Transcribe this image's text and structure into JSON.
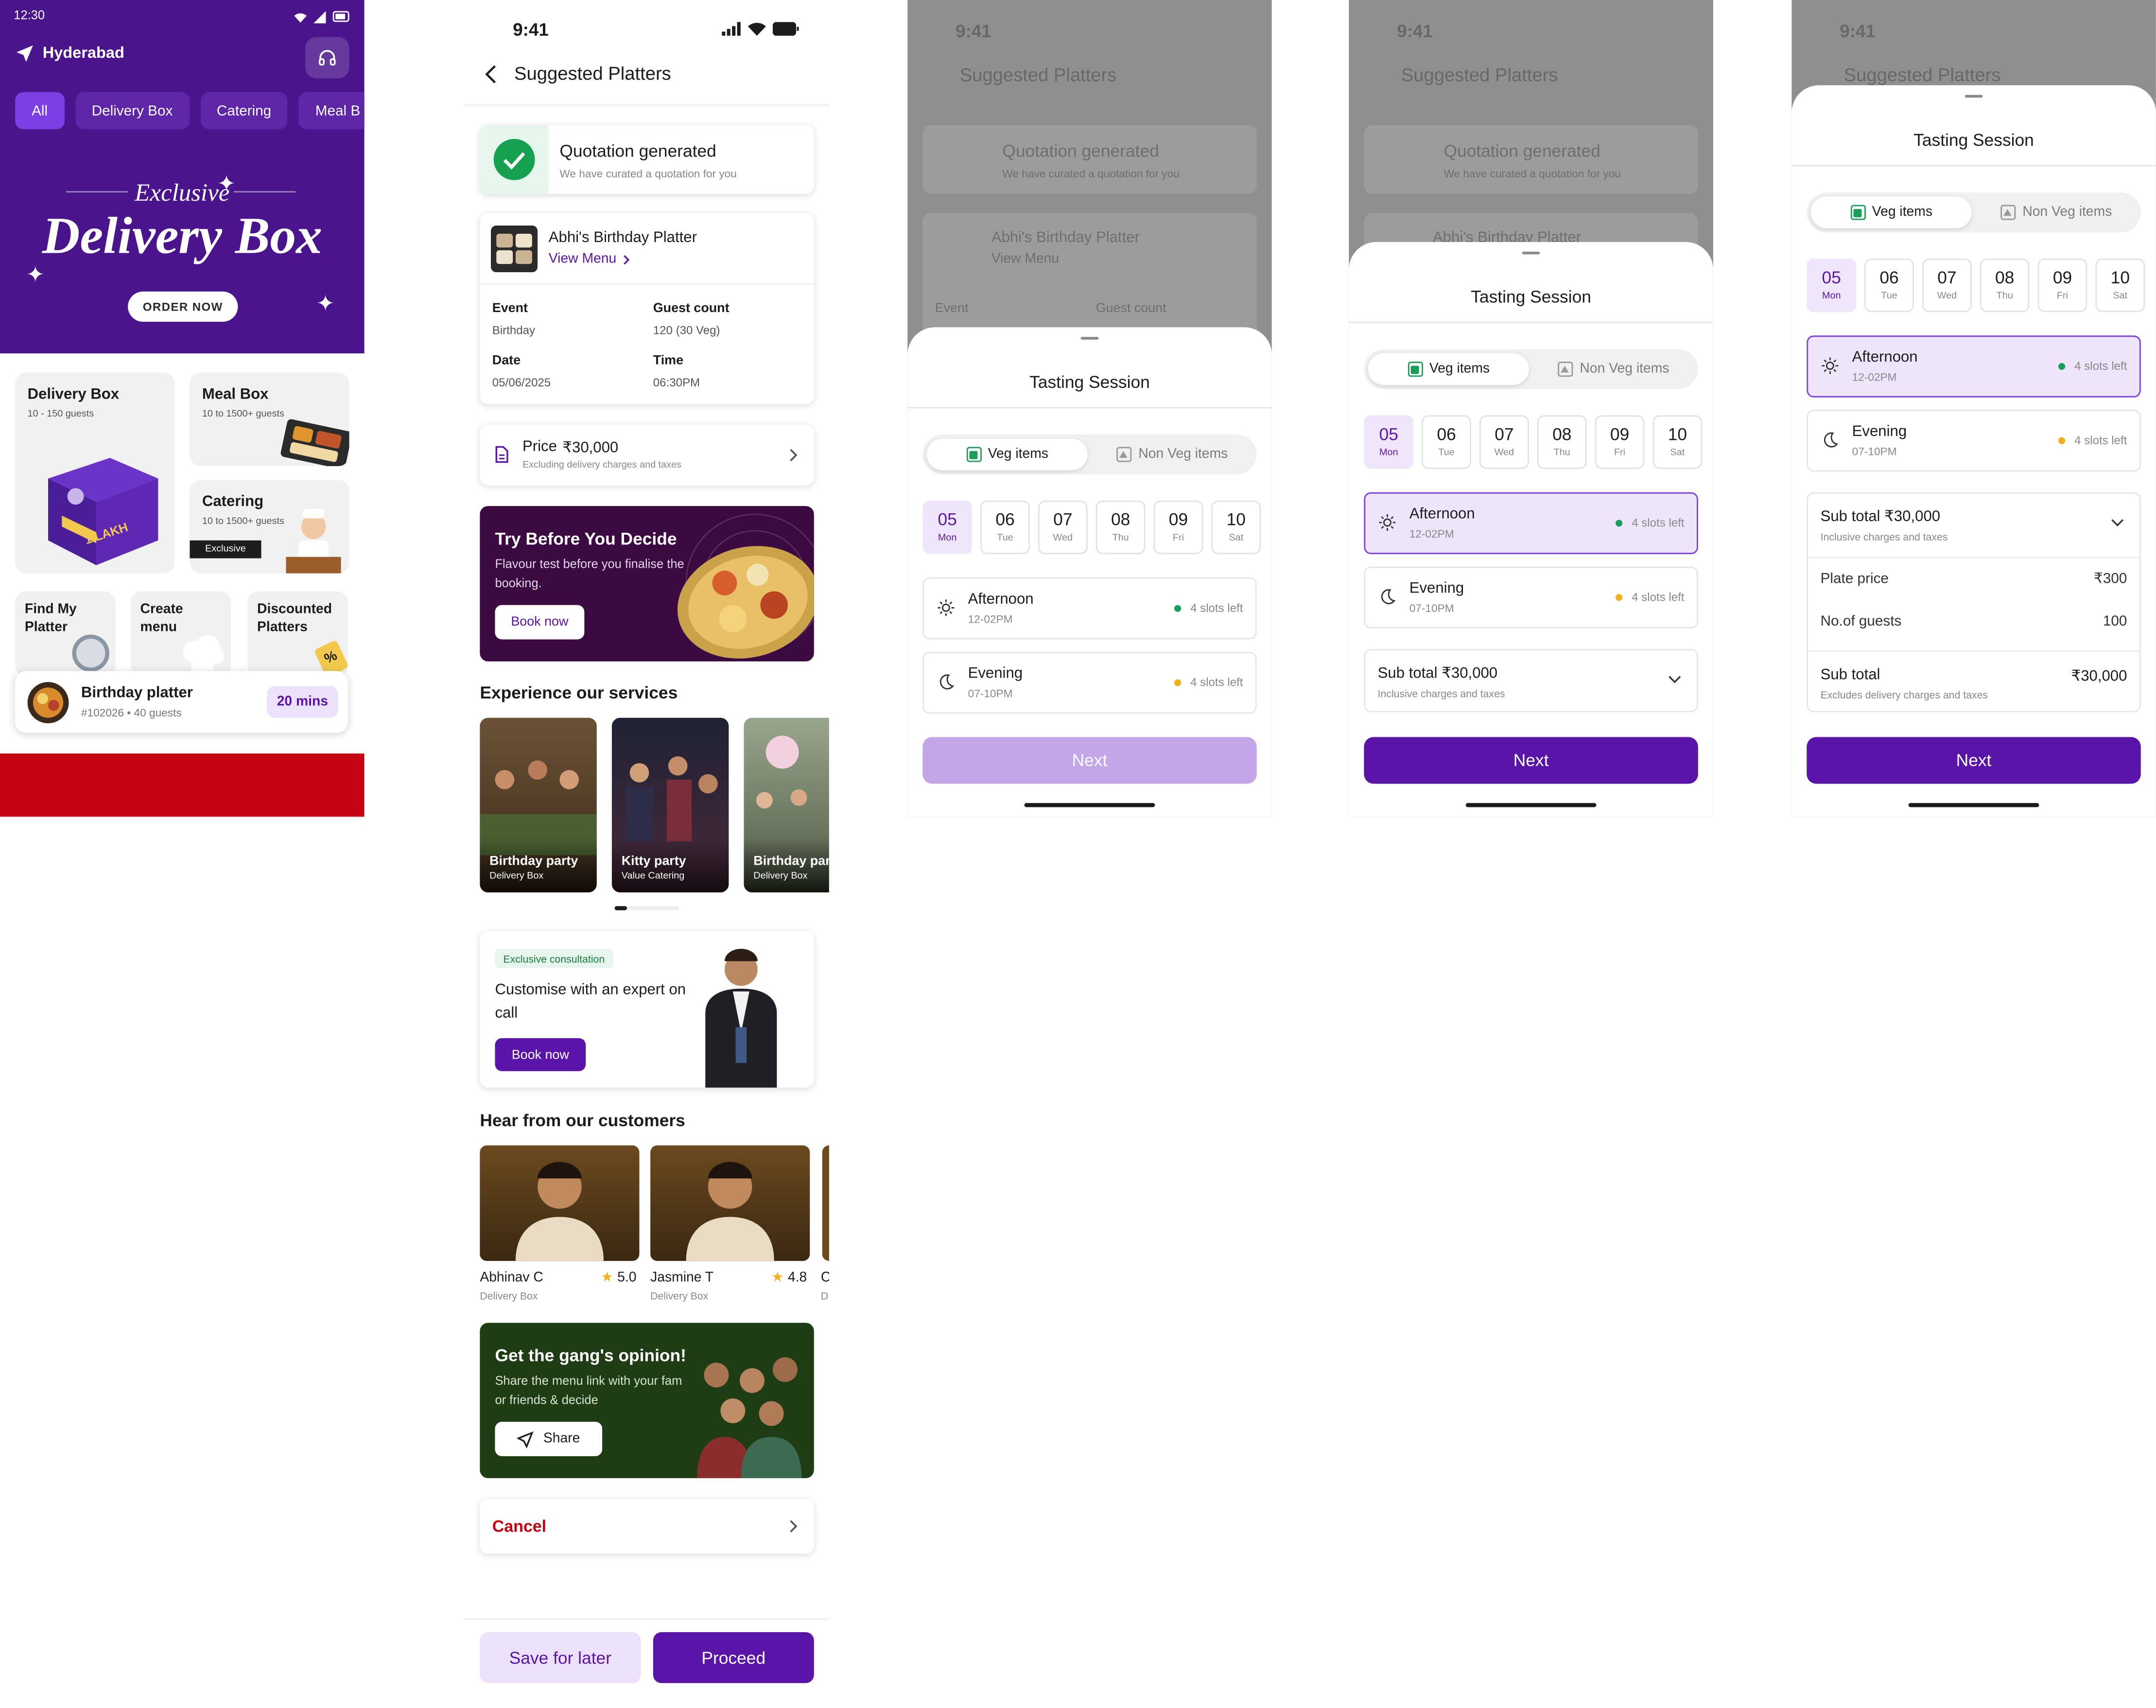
{
  "screen1": {
    "status_time": "12:30",
    "location": "Hyderabad",
    "chips": [
      "All",
      "Delivery Box",
      "Catering",
      "Meal B"
    ],
    "banner": {
      "line1": "Exclusive",
      "line2": "Delivery Box",
      "cta": "ORDER NOW"
    },
    "cards": {
      "delivery_box": {
        "title": "Delivery Box",
        "sub": "10 - 150 guests",
        "box_text": "1 LAKH"
      },
      "meal_box": {
        "title": "Meal Box",
        "sub": "10 to 1500+ guests"
      },
      "catering": {
        "title": "Catering",
        "sub": "10 to 1500+ guests",
        "badge": "Exclusive"
      },
      "find_platter": {
        "line1": "Find My",
        "line2": "Platter"
      },
      "create_menu": {
        "line1": "Create",
        "line2": "menu"
      },
      "discounted": {
        "line1": "Discounted",
        "line2": "Platters",
        "tag": "%"
      }
    },
    "order": {
      "title": "Birthday platter",
      "sub": "#102026 • 40 guests",
      "eta": "20 mins"
    },
    "colors": {
      "header": "#4a148c",
      "bottom": "#c40412"
    }
  },
  "screen2": {
    "status_time": "9:41",
    "title": "Suggested Platters",
    "quote": {
      "title": "Quotation generated",
      "sub": "We have curated a quotation for you"
    },
    "platter": {
      "name": "Abhi's Birthday Platter",
      "link": "View Menu",
      "event_label": "Event",
      "event": "Birthday",
      "guest_label": "Guest count",
      "guests": "120 (30 Veg)",
      "date_label": "Date",
      "date": "05/06/2025",
      "time_label": "Time",
      "time": "06:30PM"
    },
    "price": {
      "label": "Price",
      "value": "₹30,000",
      "sub": "Excluding delivery charges and taxes"
    },
    "try_banner": {
      "title": "Try Before You Decide",
      "sub": "Flavour test before you finalise the booking.",
      "cta": "Book now"
    },
    "services_title": "Experience our services",
    "services": [
      {
        "name": "Birthday party",
        "sub": "Delivery Box"
      },
      {
        "name": "Kitty party",
        "sub": "Value Catering"
      },
      {
        "name": "Birthday party",
        "sub": "Delivery Box"
      }
    ],
    "consult": {
      "tag": "Exclusive consultation",
      "title": "Customise with an expert on call",
      "cta": "Book now"
    },
    "customers_title": "Hear from our customers",
    "customers": [
      {
        "name": "Abhinav C",
        "sub": "Delivery Box",
        "rating": "5.0"
      },
      {
        "name": "Jasmine T",
        "sub": "Delivery Box",
        "rating": "4.8"
      },
      {
        "name": "C",
        "sub": "D",
        "rating": ""
      }
    ],
    "gang": {
      "title": "Get the gang's opinion!",
      "sub": "Share the menu link with your fam or friends & decide",
      "cta": "Share"
    },
    "cancel": "Cancel",
    "save_later": "Save for later",
    "proceed": "Proceed",
    "colors": {
      "accent": "#5a14a8",
      "cancel": "#c40412"
    }
  },
  "tasting": {
    "bg_title": "Suggested Platters",
    "bg_quote": "Quotation generated",
    "bg_quote_sub": "We have curated a quotation for you",
    "bg_platter": "Abhi's Birthday Platter",
    "bg_link": "View Menu",
    "bg_event": "Event",
    "bg_guest": "Guest count",
    "status_time": "9:41",
    "title": "Tasting Session",
    "veg": "Veg items",
    "nonveg": "Non Veg items",
    "dates": [
      {
        "d": "05",
        "w": "Mon"
      },
      {
        "d": "06",
        "w": "Tue"
      },
      {
        "d": "07",
        "w": "Wed"
      },
      {
        "d": "08",
        "w": "Thu"
      },
      {
        "d": "09",
        "w": "Fri"
      },
      {
        "d": "10",
        "w": "Sat"
      }
    ],
    "afternoon": {
      "name": "Afternoon",
      "time": "12-02PM",
      "slots": "4 slots left"
    },
    "evening": {
      "name": "Evening",
      "time": "07-10PM",
      "slots": "4 slots left"
    },
    "subtotal": {
      "title": "Sub total ₹30,000",
      "sub": "Inclusive charges and taxes"
    },
    "plate_price_label": "Plate price",
    "plate_price": "₹300",
    "guests_label": "No.of guests",
    "guests": "100",
    "final_label": "Sub total",
    "final": "₹30,000",
    "final_sub": "Excludes delivery charges and taxes",
    "next": "Next",
    "colors": {
      "next_disabled": "#c2a6e8",
      "next": "#5a14a8",
      "green_dot": "#1b9e5a",
      "amber_dot": "#f2b01e"
    }
  }
}
